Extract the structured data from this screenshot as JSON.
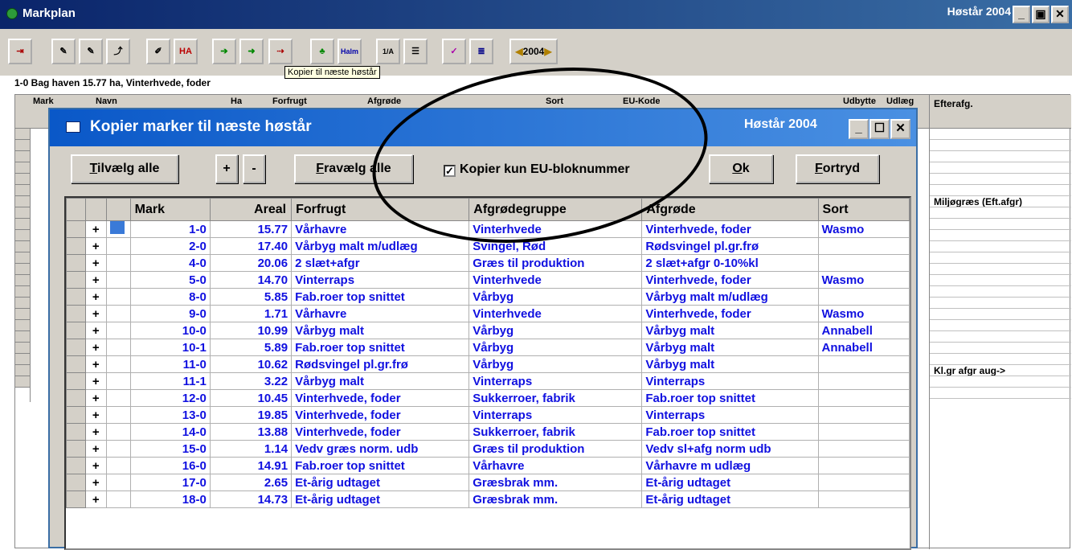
{
  "window": {
    "title": "Markplan",
    "year_label": "Høstår 2004"
  },
  "toolbar": {
    "buttons": [
      "exit",
      "edit1",
      "edit2",
      "nav",
      "tool1",
      "HA",
      "arrow1",
      "arrow2",
      "copy",
      "tool2",
      "Halm",
      "calc",
      "doc",
      "edit3",
      "list"
    ],
    "year": "2004",
    "tooltip": "Kopier til næste høstår"
  },
  "info_line": "1-0 Bag haven 15.77 ha, Vinterhvede, foder",
  "background_grid": {
    "columns": [
      "Mark",
      "Navn",
      "Ha",
      "Forfrugt",
      "Afgrøde",
      "Sort",
      "EU-Kode",
      "Udbytte",
      "Udlæg",
      "Efterafg."
    ],
    "right_rows": [
      "",
      "",
      "",
      "",
      "",
      "",
      "Miljøgræs (Eft.afgr)",
      "",
      "",
      "",
      "",
      "",
      "",
      "",
      "",
      "",
      "",
      "",
      "",
      "",
      "",
      "Kl.gr  afgr aug->",
      "",
      ""
    ]
  },
  "dialog": {
    "title": "Kopier marker til næste høstår",
    "year_label": "Høstår 2004",
    "btn_select_all": "Tilvælg alle",
    "btn_plus": "+",
    "btn_minus": "-",
    "btn_deselect_all": "Fravælg alle",
    "checkbox_label": "Kopier kun EU-bloknummer",
    "checkbox_checked": true,
    "btn_ok": "Ok",
    "btn_cancel": "Fortryd",
    "columns": [
      "Mark",
      "Areal",
      "Forfrugt",
      "Afgrødegruppe",
      "Afgrøde",
      "Sort"
    ],
    "rows": [
      {
        "mark": "1-0",
        "areal": "15.77",
        "forfrugt": "Vårhavre",
        "gruppe": "Vinterhvede",
        "afgrode": "Vinterhvede, foder",
        "sort": "Wasmo"
      },
      {
        "mark": "2-0",
        "areal": "17.40",
        "forfrugt": "Vårbyg malt m/udlæg",
        "gruppe": "Svingel, Rød",
        "afgrode": "Rødsvingel pl.gr.frø",
        "sort": ""
      },
      {
        "mark": "4-0",
        "areal": "20.06",
        "forfrugt": "2 slæt+afgr",
        "gruppe": "Græs til produktion",
        "afgrode": "2 slæt+afgr 0-10%kl",
        "sort": ""
      },
      {
        "mark": "5-0",
        "areal": "14.70",
        "forfrugt": "Vinterraps",
        "gruppe": "Vinterhvede",
        "afgrode": "Vinterhvede, foder",
        "sort": "Wasmo"
      },
      {
        "mark": "8-0",
        "areal": "5.85",
        "forfrugt": "Fab.roer top snittet",
        "gruppe": "Vårbyg",
        "afgrode": "Vårbyg malt m/udlæg",
        "sort": ""
      },
      {
        "mark": "9-0",
        "areal": "1.71",
        "forfrugt": "Vårhavre",
        "gruppe": "Vinterhvede",
        "afgrode": "Vinterhvede, foder",
        "sort": "Wasmo"
      },
      {
        "mark": "10-0",
        "areal": "10.99",
        "forfrugt": "Vårbyg malt",
        "gruppe": "Vårbyg",
        "afgrode": "Vårbyg malt",
        "sort": "Annabell"
      },
      {
        "mark": "10-1",
        "areal": "5.89",
        "forfrugt": "Fab.roer top snittet",
        "gruppe": "Vårbyg",
        "afgrode": "Vårbyg malt",
        "sort": "Annabell"
      },
      {
        "mark": "11-0",
        "areal": "10.62",
        "forfrugt": "Rødsvingel pl.gr.frø",
        "gruppe": "Vårbyg",
        "afgrode": "Vårbyg malt",
        "sort": ""
      },
      {
        "mark": "11-1",
        "areal": "3.22",
        "forfrugt": "Vårbyg malt",
        "gruppe": "Vinterraps",
        "afgrode": "Vinterraps",
        "sort": ""
      },
      {
        "mark": "12-0",
        "areal": "10.45",
        "forfrugt": "Vinterhvede, foder",
        "gruppe": "Sukkerroer, fabrik",
        "afgrode": "Fab.roer top snittet",
        "sort": ""
      },
      {
        "mark": "13-0",
        "areal": "19.85",
        "forfrugt": "Vinterhvede, foder",
        "gruppe": "Vinterraps",
        "afgrode": "Vinterraps",
        "sort": ""
      },
      {
        "mark": "14-0",
        "areal": "13.88",
        "forfrugt": "Vinterhvede, foder",
        "gruppe": "Sukkerroer, fabrik",
        "afgrode": "Fab.roer top snittet",
        "sort": ""
      },
      {
        "mark": "15-0",
        "areal": "1.14",
        "forfrugt": "Vedv græs norm. udb",
        "gruppe": "Græs til produktion",
        "afgrode": "Vedv sl+afg norm udb",
        "sort": ""
      },
      {
        "mark": "16-0",
        "areal": "14.91",
        "forfrugt": "Fab.roer top snittet",
        "gruppe": "Vårhavre",
        "afgrode": "Vårhavre m udlæg",
        "sort": ""
      },
      {
        "mark": "17-0",
        "areal": "2.65",
        "forfrugt": "Et-årig udtaget",
        "gruppe": "Græsbrak mm.",
        "afgrode": "Et-årig udtaget",
        "sort": ""
      },
      {
        "mark": "18-0",
        "areal": "14.73",
        "forfrugt": "Et-årig udtaget",
        "gruppe": "Græsbrak mm.",
        "afgrode": "Et-årig udtaget",
        "sort": ""
      }
    ]
  }
}
